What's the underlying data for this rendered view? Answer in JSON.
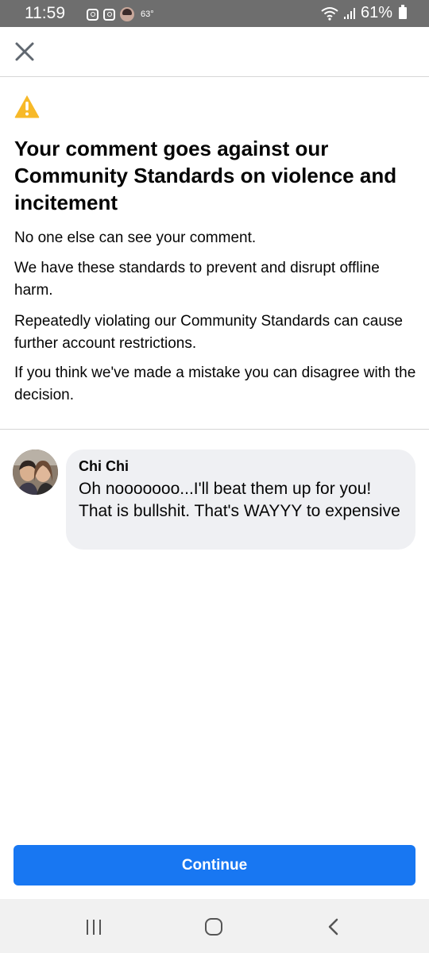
{
  "status_bar": {
    "time": "11:59",
    "temperature": "63°",
    "battery": "61%",
    "icons": [
      "instagram-icon",
      "instagram-icon",
      "avatar-notification-icon",
      "wifi-icon",
      "signal-icon",
      "battery-icon"
    ]
  },
  "top_bar": {
    "close_icon": "close-icon"
  },
  "notice": {
    "icon": "warning-icon",
    "icon_color": "#f7b928",
    "heading": "Your comment goes against our Community Standards on violence and incitement",
    "paragraphs": [
      "No one else can see your comment.",
      "We have these standards to prevent and disrupt offline harm.",
      "Repeatedly violating our Community Standards can cause further account restrictions.",
      "If you think we've made a mistake you can disagree with the decision."
    ]
  },
  "comment": {
    "author": "Chi Chi",
    "text": "Oh nooooooo...I'll beat them up for you! That is bullshit. That's WAYYY to expensive"
  },
  "actions": {
    "continue_label": "Continue",
    "accent_color": "#1877f2"
  },
  "nav_bar": {
    "icons": [
      "recent-apps-icon",
      "home-icon",
      "back-icon"
    ]
  }
}
